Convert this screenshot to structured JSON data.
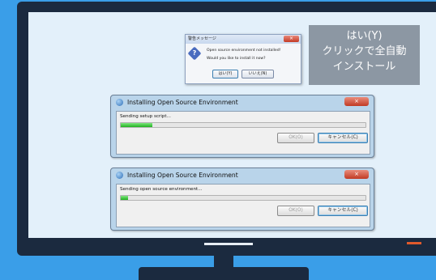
{
  "message_box": {
    "title": "警告メッセージ",
    "close_symbol": "×",
    "icon_glyph": "?",
    "line1": "Open source environment not installed!",
    "line2": "Would you like to install it now?",
    "yes_label": "はい(Y)",
    "no_label": "いいえ(N)"
  },
  "callout": {
    "line1": "はい(Y)",
    "line2": "クリックで全自動",
    "line3": "インストール"
  },
  "dialogs": [
    {
      "title": "Installing Open Source Environment",
      "close_symbol": "×",
      "status": "Sending setup script...",
      "progress": 0.13,
      "ok_label": "OK(O)",
      "cancel_label": "キャンセル(C)"
    },
    {
      "title": "Installing Open Source Environment",
      "close_symbol": "×",
      "status": "Sending open source environment...",
      "progress": 0.03,
      "ok_label": "OK(O)",
      "cancel_label": "キャンセル(C)"
    }
  ],
  "colors": {
    "background": "#3a9ee8",
    "monitor": "#1b2a3f",
    "screen": "#e3f0fa",
    "callout": "#8c97a3",
    "progress": "#21b121"
  }
}
